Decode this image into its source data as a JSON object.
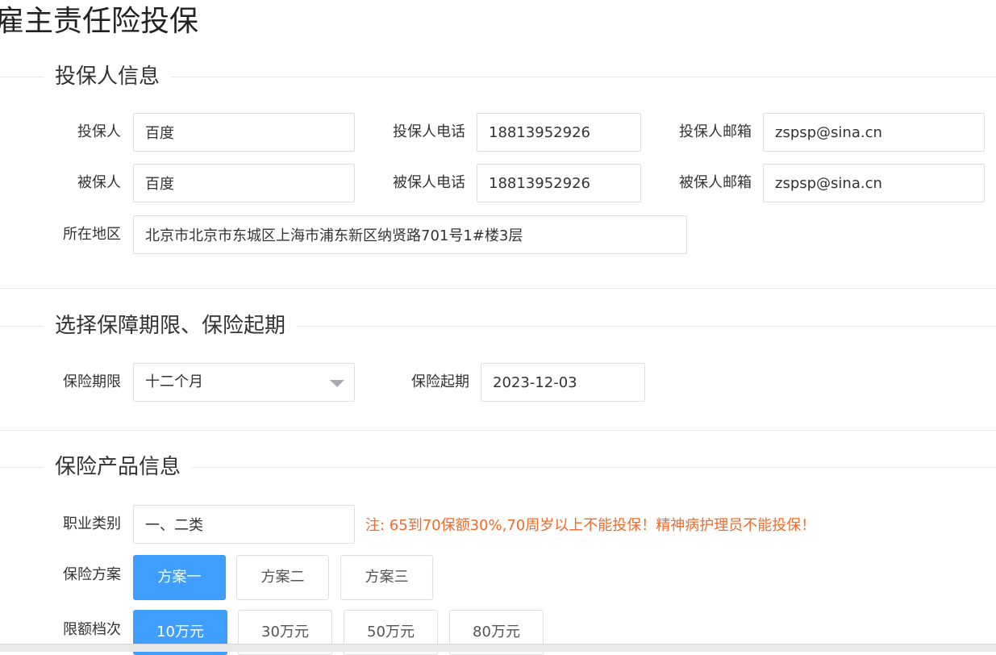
{
  "page": {
    "title": "雇主责任险投保"
  },
  "applicant_section": {
    "title": "投保人信息",
    "fields": {
      "applicant_label": "投保人",
      "applicant_value": "百度",
      "applicant_phone_label": "投保人电话",
      "applicant_phone_value": "18813952926",
      "applicant_email_label": "投保人邮箱",
      "applicant_email_value": "zspsp@sina.cn",
      "insured_label": "被保人",
      "insured_value": "百度",
      "insured_phone_label": "被保人电话",
      "insured_phone_value": "18813952926",
      "insured_email_label": "被保人邮箱",
      "insured_email_value": "zspsp@sina.cn",
      "region_label": "所在地区",
      "region_value": "北京市北京市东城区上海市浦东新区纳贤路701号1#楼3层"
    }
  },
  "period_section": {
    "title": "选择保障期限、保险起期",
    "term_label": "保险期限",
    "term_value": "十二个月",
    "start_label": "保险起期",
    "start_value": "2023-12-03"
  },
  "product_section": {
    "title": "保险产品信息",
    "occupation_label": "职业类别",
    "occupation_value": "一、二类",
    "note": "注: 65到70保额30%,70周岁以上不能投保！精神病护理员不能投保！",
    "plan_label": "保险方案",
    "plans": [
      "方案一",
      "方案二",
      "方案三"
    ],
    "plan_selected": "方案一",
    "limit_label": "限额档次",
    "limits": [
      "10万元",
      "30万元",
      "50万元",
      "80万元"
    ],
    "limit_selected": "10万元"
  },
  "colors": {
    "primary": "#409eff",
    "note": "#f26b2a",
    "border": "#dcdfe6",
    "divider": "#e8e8e8"
  },
  "icons": {
    "select_arrow": "caret-down-icon"
  }
}
